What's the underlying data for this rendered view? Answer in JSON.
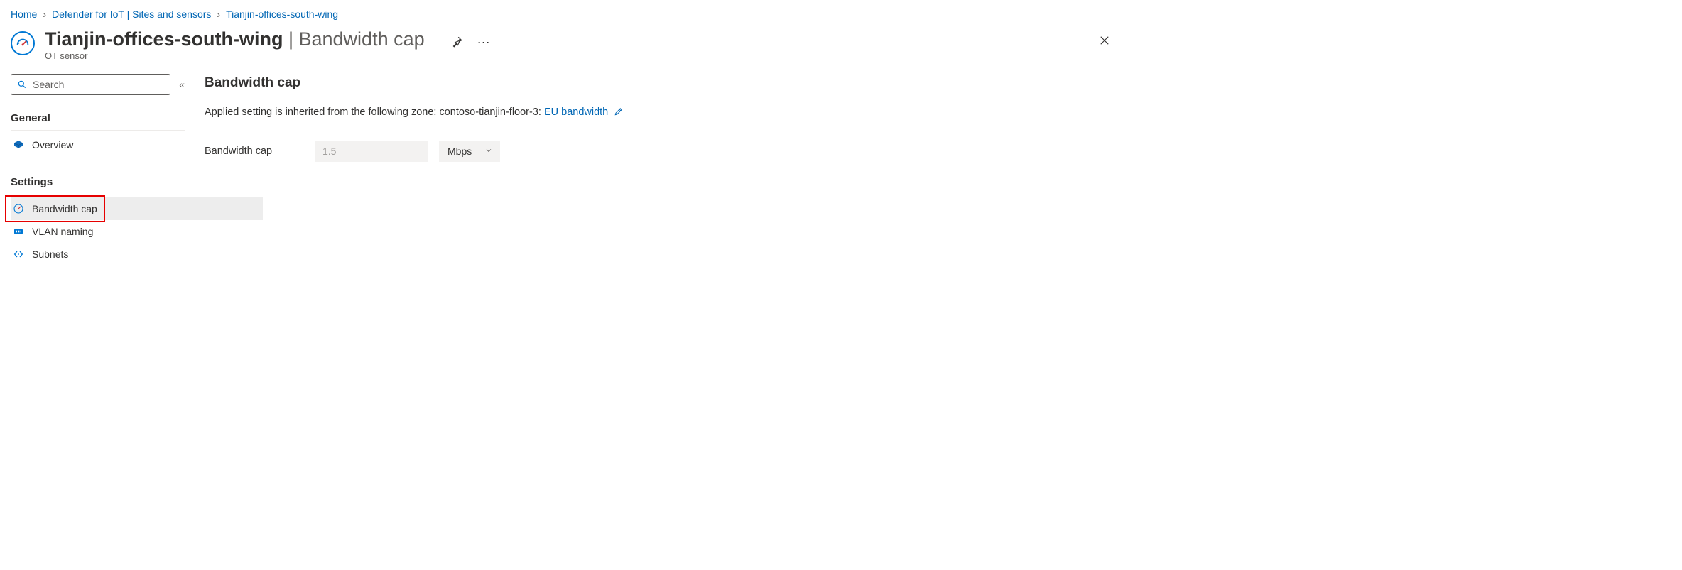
{
  "breadcrumb": {
    "home": "Home",
    "middle": "Defender for IoT | Sites and sensors",
    "current": "Tianjin-offices-south-wing"
  },
  "title": {
    "name": "Tianjin-offices-south-wing",
    "suffix": " | Bandwidth cap",
    "subtitle": "OT sensor"
  },
  "search": {
    "placeholder": "Search"
  },
  "sidebar": {
    "general_header": "General",
    "settings_header": "Settings",
    "overview": "Overview",
    "bandwidth_cap": "Bandwidth cap",
    "vlan_naming": "VLAN naming",
    "subnets": "Subnets"
  },
  "content": {
    "heading": "Bandwidth cap",
    "desc_prefix": "Applied setting is inherited from the following zone: contoso-tianjin-floor-3: ",
    "desc_link": "EU bandwidth",
    "form_label": "Bandwidth cap",
    "form_value": "1.5",
    "form_unit": "Mbps"
  }
}
